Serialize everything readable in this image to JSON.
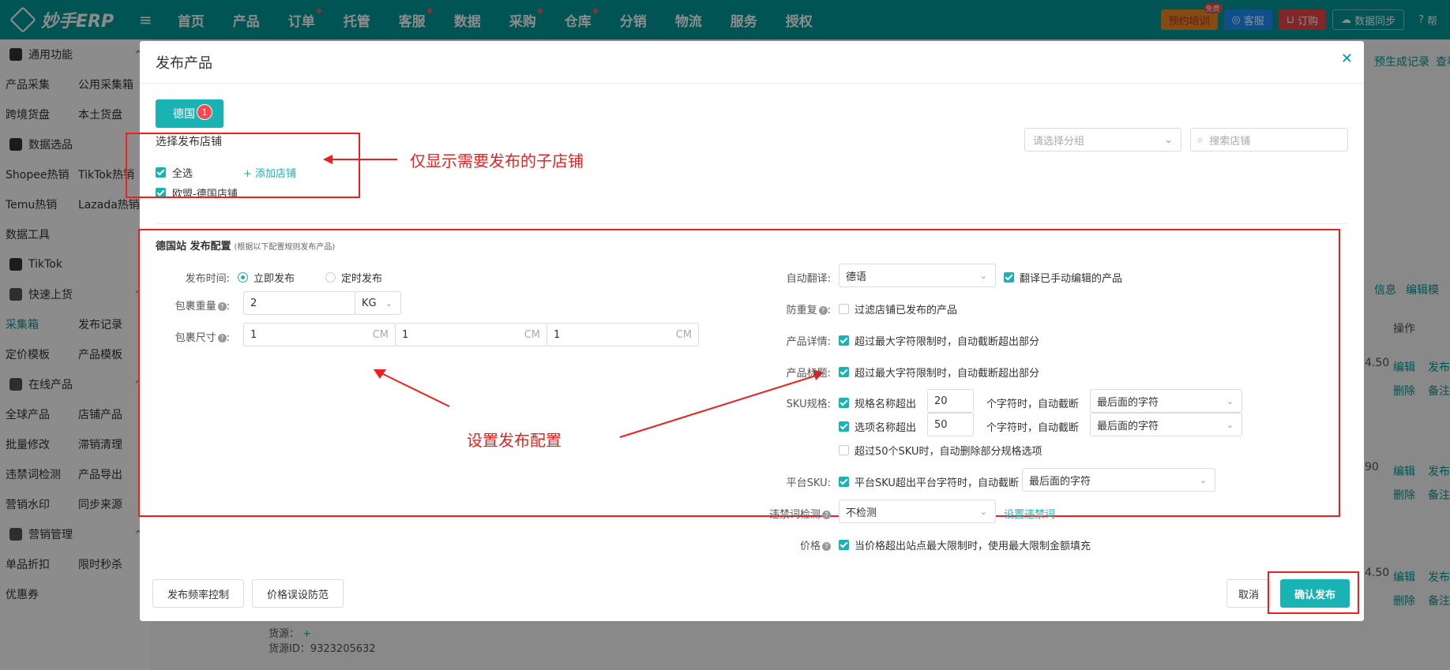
{
  "topbar": {
    "logo_text": "妙手ERP",
    "nav": [
      "首页",
      "产品",
      "订单",
      "托管",
      "客服",
      "数据",
      "采购",
      "仓库",
      "分销",
      "物流",
      "服务",
      "授权"
    ],
    "training_label": "预约培训",
    "free_badge": "免费",
    "service_label": "客服",
    "order_label": "订购",
    "sync_label": "数据同步",
    "help_label": "帮"
  },
  "sidebar": {
    "general": "通用功能",
    "rows1": [
      [
        "产品采集",
        "公用采集箱"
      ],
      [
        "跨境货盘",
        "本土货盘"
      ]
    ],
    "data_select": "数据选品",
    "rows2": [
      [
        "Shopee热销",
        "TikTok热销"
      ],
      [
        "Temu热销",
        "Lazada热销"
      ],
      [
        "数据工具",
        ""
      ]
    ],
    "tiktok": "TikTok",
    "quick_upload": "快速上货",
    "rows3": [
      [
        "采集箱",
        "发布记录"
      ],
      [
        "定价模板",
        "产品模板"
      ]
    ],
    "online": "在线产品",
    "rows4": [
      [
        "全球产品",
        "店铺产品"
      ],
      [
        "批量修改",
        "滞销清理"
      ],
      [
        "违禁词检测",
        "产品导出"
      ],
      [
        "营销水印",
        "同步来源"
      ]
    ],
    "marketing": "营销管理",
    "rows5": [
      [
        "单品折扣",
        "限时秒杀"
      ],
      [
        "优惠券",
        ""
      ]
    ]
  },
  "background": {
    "gen_record": "预生成记录",
    "view": "查看",
    "info": "信息",
    "edit_model": "编辑模",
    "operation": "操作",
    "edit": "编辑",
    "publish": "发布",
    "delete": "删除",
    "note": "备注",
    "price1": "4.50",
    "price2": "90",
    "price3": "4.50",
    "source": "货源：",
    "source_id": "货源ID：9323205632"
  },
  "modal": {
    "title": "发布产品",
    "tab_label": "德国",
    "tab_badge": "1",
    "select_store_title": "选择发布店铺",
    "group_placeholder": "请选择分组",
    "search_placeholder": "搜索店铺",
    "select_all": "全选",
    "add_store": "+ 添加店铺",
    "store_name": "欧盟-德国店铺",
    "annotation_store": "仅显示需要发布的子店铺",
    "annotation_config": "设置发布配置",
    "config_title": "德国站 发布配置",
    "config_note": "(根据以下配置规则发布产品)",
    "publish_time_label": "发布时间:",
    "publish_now": "立即发布",
    "publish_scheduled": "定时发布",
    "weight_label": "包裹重量",
    "weight_value": "2",
    "weight_unit": "KG",
    "size_label": "包裹尺寸",
    "size_values": [
      "1",
      "1",
      "1"
    ],
    "size_unit": "CM",
    "auto_translate_label": "自动翻译:",
    "translate_lang": "德语",
    "translate_manual": "翻译已手动编辑的产品",
    "dedupe_label": "防重复",
    "dedupe_option": "过滤店铺已发布的产品",
    "detail_label": "产品详情:",
    "detail_option": "超过最大字符限制时，自动截断超出部分",
    "title_label": "产品标题:",
    "title_option": "超过最大字符限制时，自动截断超出部分",
    "sku_label": "SKU规格:",
    "sku_name_over": "规格名称超出",
    "sku_name_value": "20",
    "sku_option_over": "选项名称超出",
    "sku_option_value": "50",
    "chars_truncate": "个字符时，自动截断",
    "truncate_mode": "最后面的字符",
    "sku50": "超过50个SKU时，自动删除部分规格选项",
    "platform_sku_label": "平台SKU:",
    "platform_sku_option": "平台SKU超出平台字符时，自动截断",
    "banned_label": "违禁词检测",
    "banned_value": "不检测",
    "banned_link": "设置违禁词",
    "price_label": "价格",
    "price_option": "当价格超出站点最大限制时，使用最大限制金额填充",
    "freq_btn": "发布频率控制",
    "price_guard_btn": "价格误设防范",
    "cancel_btn": "取消",
    "confirm_btn": "确认发布"
  }
}
